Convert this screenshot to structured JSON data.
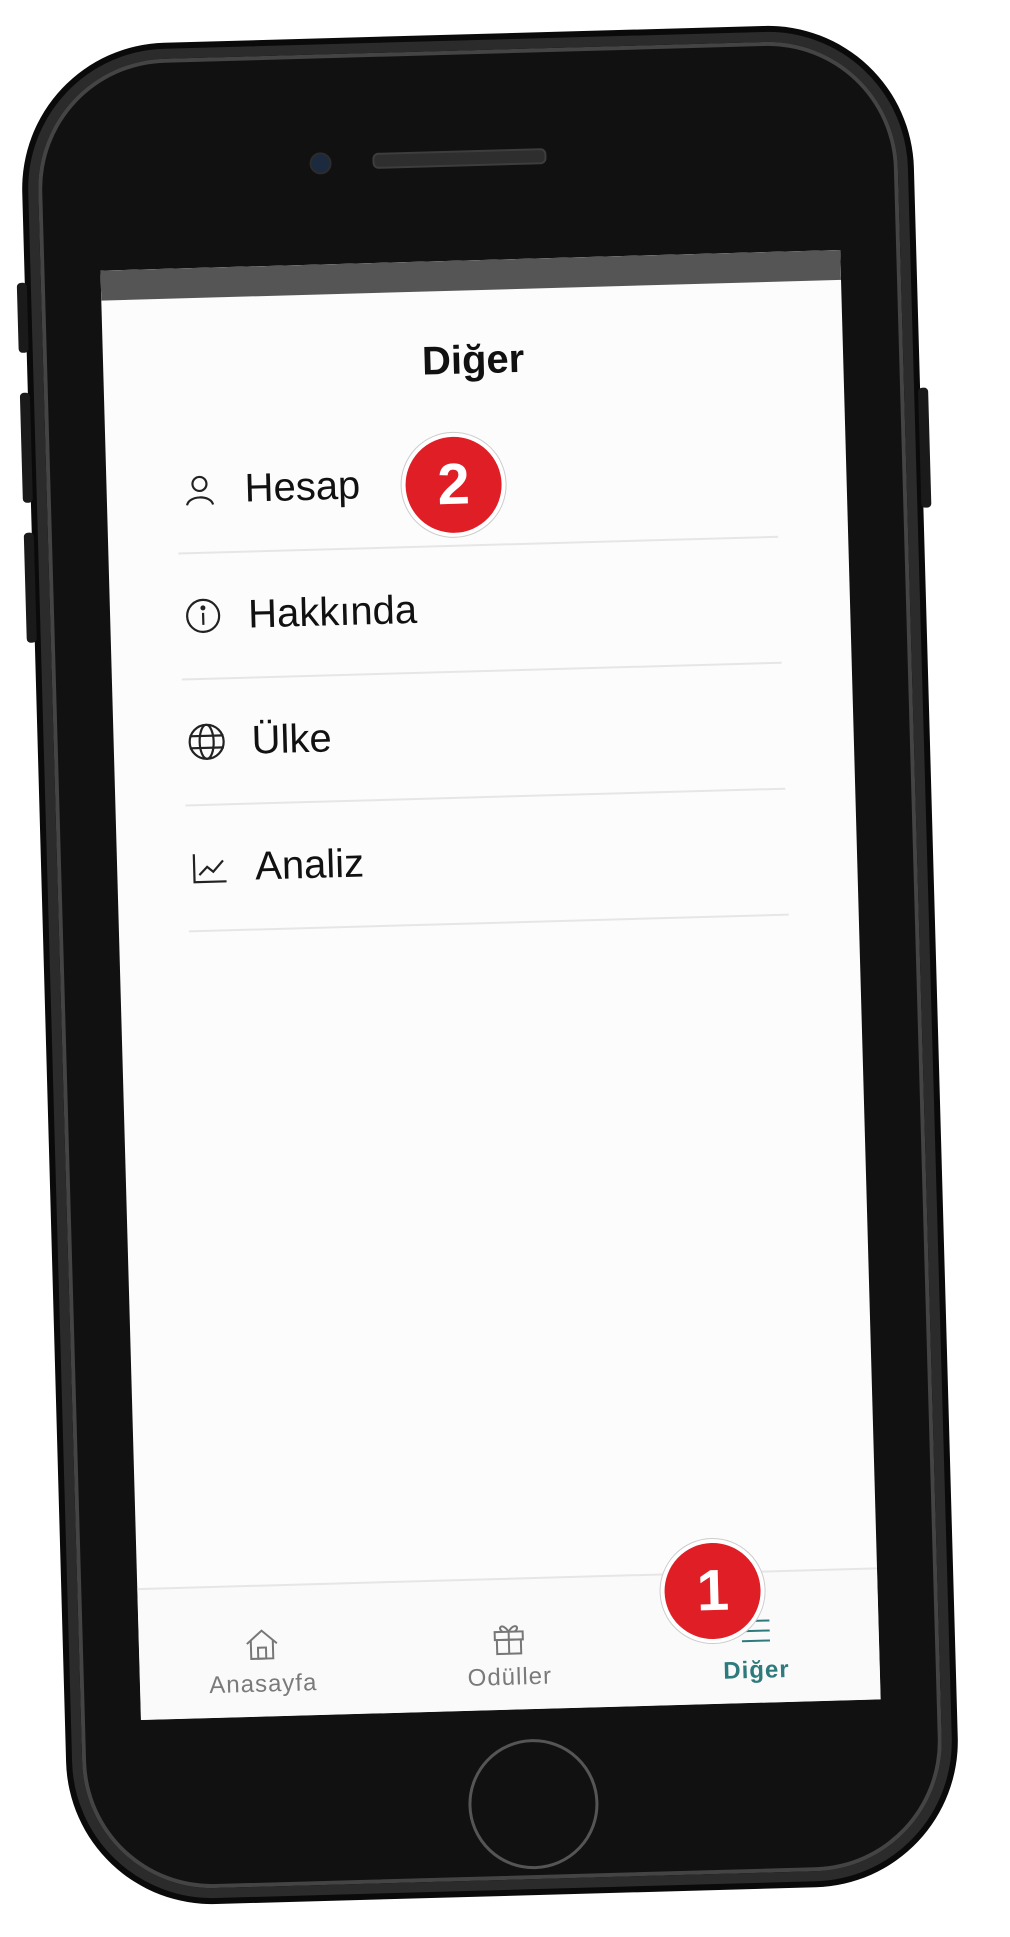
{
  "header": {
    "title": "Diğer"
  },
  "menu": {
    "items": [
      {
        "label": "Hesap",
        "icon": "user-icon"
      },
      {
        "label": "Hakkında",
        "icon": "info-icon"
      },
      {
        "label": "Ülke",
        "icon": "globe-icon"
      },
      {
        "label": "Analiz",
        "icon": "chart-icon"
      }
    ]
  },
  "tabbar": {
    "tabs": [
      {
        "label": "Anasayfa",
        "icon": "home-icon",
        "active": false
      },
      {
        "label": "Odüller",
        "icon": "gift-icon",
        "active": false
      },
      {
        "label": "Diğer",
        "icon": "menu-icon",
        "active": true
      }
    ]
  },
  "annotations": {
    "badge_1": "1",
    "badge_2": "2"
  },
  "colors": {
    "accent": "#2f7a7d",
    "badge": "#e01e26",
    "phone_frame": "#111111"
  }
}
